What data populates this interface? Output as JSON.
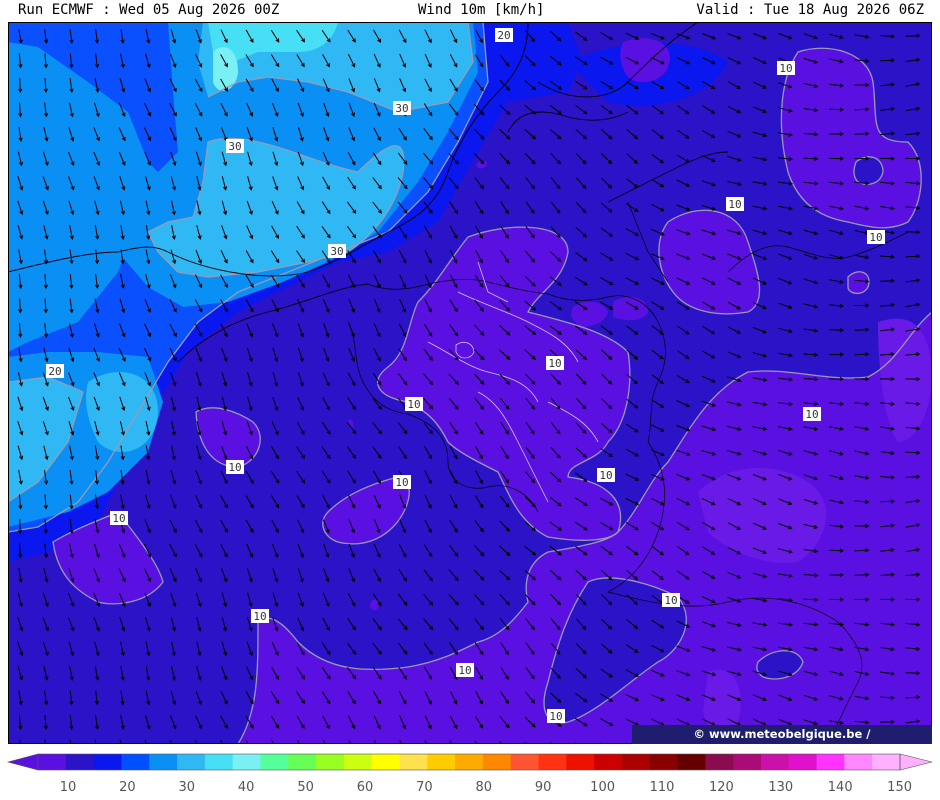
{
  "header": {
    "run": "Run ECMWF : Wed 05 Aug 2026 00Z",
    "variable": "Wind 10m [km/h]",
    "valid": "Valid : Tue 18 Aug 2026 06Z"
  },
  "credit": "© www.meteobelgique.be / www.meteobelgie.be",
  "contour_labels": [
    "20",
    "30",
    "30",
    "30",
    "20",
    "10",
    "10",
    "10",
    "10",
    "10",
    "10",
    "10",
    "10",
    "10",
    "10",
    "10",
    "10",
    "10",
    "10",
    "10",
    "10"
  ],
  "colorbar": {
    "ticks": [
      "10",
      "20",
      "30",
      "40",
      "50",
      "60",
      "70",
      "80",
      "90",
      "100",
      "110",
      "120",
      "130",
      "140",
      "150"
    ],
    "colors": [
      "#5a10e0",
      "#2b13c8",
      "#0a17ee",
      "#0050ff",
      "#0a8ff5",
      "#30b8f5",
      "#46dff5",
      "#7af0f5",
      "#55ff99",
      "#66ff55",
      "#99ff22",
      "#ccff11",
      "#ffff00",
      "#ffe14d",
      "#ffcc00",
      "#ffaa00",
      "#ff8800",
      "#ff5533",
      "#ff3311",
      "#ee1100",
      "#cc0000",
      "#aa0000",
      "#880000",
      "#660000",
      "#8a0b4f",
      "#aa0b77",
      "#cc11aa",
      "#e010cc",
      "#ff33ff",
      "#ff88ff",
      "#ffb0ff"
    ]
  },
  "map_colors": {
    "lt10": "#5a10e0",
    "c10_15": "#2b13c8",
    "c15_20": "#0a17ee",
    "c20_25": "#0a50ff",
    "c25_30": "#0a8ff5",
    "c30_35": "#30b8f5",
    "c35_40": "#46dff5",
    "c40_45": "#7af0f5"
  }
}
